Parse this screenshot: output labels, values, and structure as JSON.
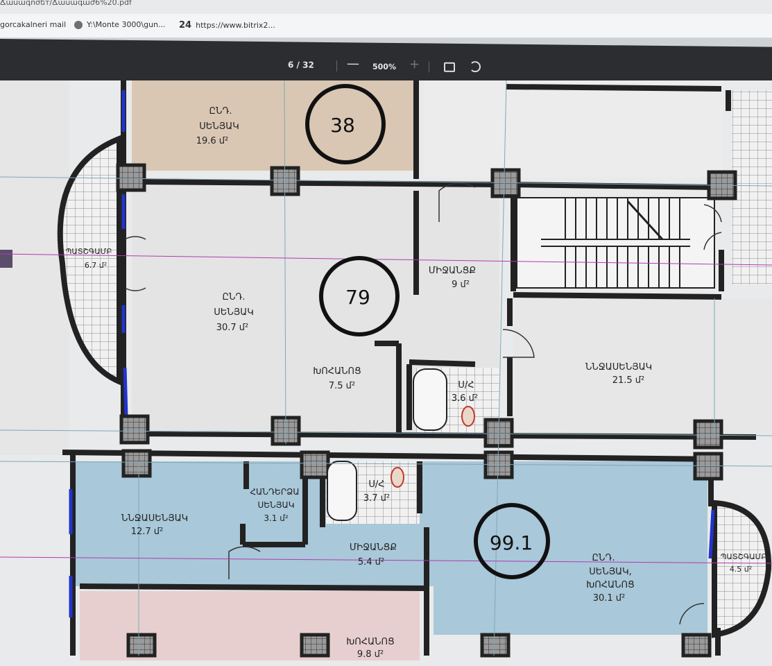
{
  "browser": {
    "tab_title_fragment": "Ճասագոσեт/Ճասագաժ6%20.pdf",
    "bookmarks": [
      {
        "label": "gorcakalneri mail",
        "icon": "page-icon"
      },
      {
        "label": "Y:\\Monte 3000\\gun...",
        "icon": "globe-icon"
      },
      {
        "label": "https://www.bitrix2...",
        "badge": "24",
        "icon": "bitrix-icon"
      }
    ]
  },
  "pdf_toolbar": {
    "page_indicator": "6  /  32",
    "zoom_out": "—",
    "zoom": "500%",
    "zoom_in": "+",
    "fit_icon": "fit-page-icon",
    "rotate_icon": "rotate-icon"
  },
  "plan": {
    "apartments": [
      {
        "number": "38"
      },
      {
        "number": "79"
      },
      {
        "number": "99.1"
      }
    ],
    "rooms": [
      {
        "name": "ԸՆԴ.",
        "name2": "ՍԵՆՅԱԿ",
        "area": "19.6 մ²"
      },
      {
        "name": "ՊԱՏՇԳԱՄԲ",
        "area": "6.7 մ²"
      },
      {
        "name": "ԸՆԴ.",
        "name2": "ՍԵՆՅԱԿ",
        "area": "30.7 մ²"
      },
      {
        "name": "ՄԻՋԱՆՑՔ",
        "area": "9 մ²"
      },
      {
        "name": "ԽՈՀԱՆՈՑ",
        "area": "7.5 մ²"
      },
      {
        "name": "Ս/Հ",
        "area": "3.6 մ²"
      },
      {
        "name": "ՆՆՋԱՍԵՆՅԱԿ",
        "area": "21.5 մ²"
      },
      {
        "name": "ՆՆՋԱՍԵՆՅԱԿ",
        "area": "12.7 մ²"
      },
      {
        "name": "ՀԱՆԴԵՐՁԱ",
        "name2": "ՍԵՆՅԱԿ",
        "area": "3.1 մ²"
      },
      {
        "name": "Ս/Հ",
        "area": "3.7 մ²"
      },
      {
        "name": "ՄԻՋԱՆՑՔ",
        "area": "5.4 մ²"
      },
      {
        "name": "ԸՆԴ.",
        "name2": "ՍԵՆՅԱԿ,",
        "name3": "ԽՈՀԱՆՈՑ",
        "area": "30.1 մ²"
      },
      {
        "name": "ՊԱՏՇԳԱՄԲ",
        "area": "4.5 մ²"
      },
      {
        "name": "ԽՈՀԱՆՈՑ",
        "area": "9.8 մ²"
      }
    ]
  }
}
